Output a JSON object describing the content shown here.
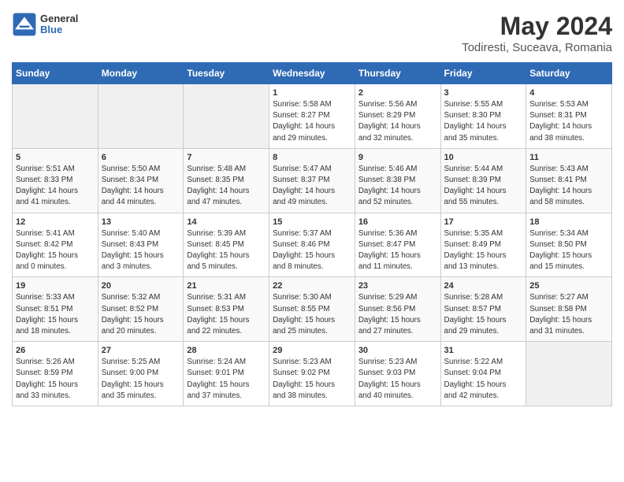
{
  "header": {
    "logo_line1": "General",
    "logo_line2": "Blue",
    "title": "May 2024",
    "subtitle": "Todiresti, Suceava, Romania"
  },
  "calendar": {
    "days_of_week": [
      "Sunday",
      "Monday",
      "Tuesday",
      "Wednesday",
      "Thursday",
      "Friday",
      "Saturday"
    ],
    "weeks": [
      [
        {
          "day": "",
          "info": ""
        },
        {
          "day": "",
          "info": ""
        },
        {
          "day": "",
          "info": ""
        },
        {
          "day": "1",
          "info": "Sunrise: 5:58 AM\nSunset: 8:27 PM\nDaylight: 14 hours\nand 29 minutes."
        },
        {
          "day": "2",
          "info": "Sunrise: 5:56 AM\nSunset: 8:29 PM\nDaylight: 14 hours\nand 32 minutes."
        },
        {
          "day": "3",
          "info": "Sunrise: 5:55 AM\nSunset: 8:30 PM\nDaylight: 14 hours\nand 35 minutes."
        },
        {
          "day": "4",
          "info": "Sunrise: 5:53 AM\nSunset: 8:31 PM\nDaylight: 14 hours\nand 38 minutes."
        }
      ],
      [
        {
          "day": "5",
          "info": "Sunrise: 5:51 AM\nSunset: 8:33 PM\nDaylight: 14 hours\nand 41 minutes."
        },
        {
          "day": "6",
          "info": "Sunrise: 5:50 AM\nSunset: 8:34 PM\nDaylight: 14 hours\nand 44 minutes."
        },
        {
          "day": "7",
          "info": "Sunrise: 5:48 AM\nSunset: 8:35 PM\nDaylight: 14 hours\nand 47 minutes."
        },
        {
          "day": "8",
          "info": "Sunrise: 5:47 AM\nSunset: 8:37 PM\nDaylight: 14 hours\nand 49 minutes."
        },
        {
          "day": "9",
          "info": "Sunrise: 5:46 AM\nSunset: 8:38 PM\nDaylight: 14 hours\nand 52 minutes."
        },
        {
          "day": "10",
          "info": "Sunrise: 5:44 AM\nSunset: 8:39 PM\nDaylight: 14 hours\nand 55 minutes."
        },
        {
          "day": "11",
          "info": "Sunrise: 5:43 AM\nSunset: 8:41 PM\nDaylight: 14 hours\nand 58 minutes."
        }
      ],
      [
        {
          "day": "12",
          "info": "Sunrise: 5:41 AM\nSunset: 8:42 PM\nDaylight: 15 hours\nand 0 minutes."
        },
        {
          "day": "13",
          "info": "Sunrise: 5:40 AM\nSunset: 8:43 PM\nDaylight: 15 hours\nand 3 minutes."
        },
        {
          "day": "14",
          "info": "Sunrise: 5:39 AM\nSunset: 8:45 PM\nDaylight: 15 hours\nand 5 minutes."
        },
        {
          "day": "15",
          "info": "Sunrise: 5:37 AM\nSunset: 8:46 PM\nDaylight: 15 hours\nand 8 minutes."
        },
        {
          "day": "16",
          "info": "Sunrise: 5:36 AM\nSunset: 8:47 PM\nDaylight: 15 hours\nand 11 minutes."
        },
        {
          "day": "17",
          "info": "Sunrise: 5:35 AM\nSunset: 8:49 PM\nDaylight: 15 hours\nand 13 minutes."
        },
        {
          "day": "18",
          "info": "Sunrise: 5:34 AM\nSunset: 8:50 PM\nDaylight: 15 hours\nand 15 minutes."
        }
      ],
      [
        {
          "day": "19",
          "info": "Sunrise: 5:33 AM\nSunset: 8:51 PM\nDaylight: 15 hours\nand 18 minutes."
        },
        {
          "day": "20",
          "info": "Sunrise: 5:32 AM\nSunset: 8:52 PM\nDaylight: 15 hours\nand 20 minutes."
        },
        {
          "day": "21",
          "info": "Sunrise: 5:31 AM\nSunset: 8:53 PM\nDaylight: 15 hours\nand 22 minutes."
        },
        {
          "day": "22",
          "info": "Sunrise: 5:30 AM\nSunset: 8:55 PM\nDaylight: 15 hours\nand 25 minutes."
        },
        {
          "day": "23",
          "info": "Sunrise: 5:29 AM\nSunset: 8:56 PM\nDaylight: 15 hours\nand 27 minutes."
        },
        {
          "day": "24",
          "info": "Sunrise: 5:28 AM\nSunset: 8:57 PM\nDaylight: 15 hours\nand 29 minutes."
        },
        {
          "day": "25",
          "info": "Sunrise: 5:27 AM\nSunset: 8:58 PM\nDaylight: 15 hours\nand 31 minutes."
        }
      ],
      [
        {
          "day": "26",
          "info": "Sunrise: 5:26 AM\nSunset: 8:59 PM\nDaylight: 15 hours\nand 33 minutes."
        },
        {
          "day": "27",
          "info": "Sunrise: 5:25 AM\nSunset: 9:00 PM\nDaylight: 15 hours\nand 35 minutes."
        },
        {
          "day": "28",
          "info": "Sunrise: 5:24 AM\nSunset: 9:01 PM\nDaylight: 15 hours\nand 37 minutes."
        },
        {
          "day": "29",
          "info": "Sunrise: 5:23 AM\nSunset: 9:02 PM\nDaylight: 15 hours\nand 38 minutes."
        },
        {
          "day": "30",
          "info": "Sunrise: 5:23 AM\nSunset: 9:03 PM\nDaylight: 15 hours\nand 40 minutes."
        },
        {
          "day": "31",
          "info": "Sunrise: 5:22 AM\nSunset: 9:04 PM\nDaylight: 15 hours\nand 42 minutes."
        },
        {
          "day": "",
          "info": ""
        }
      ]
    ]
  }
}
